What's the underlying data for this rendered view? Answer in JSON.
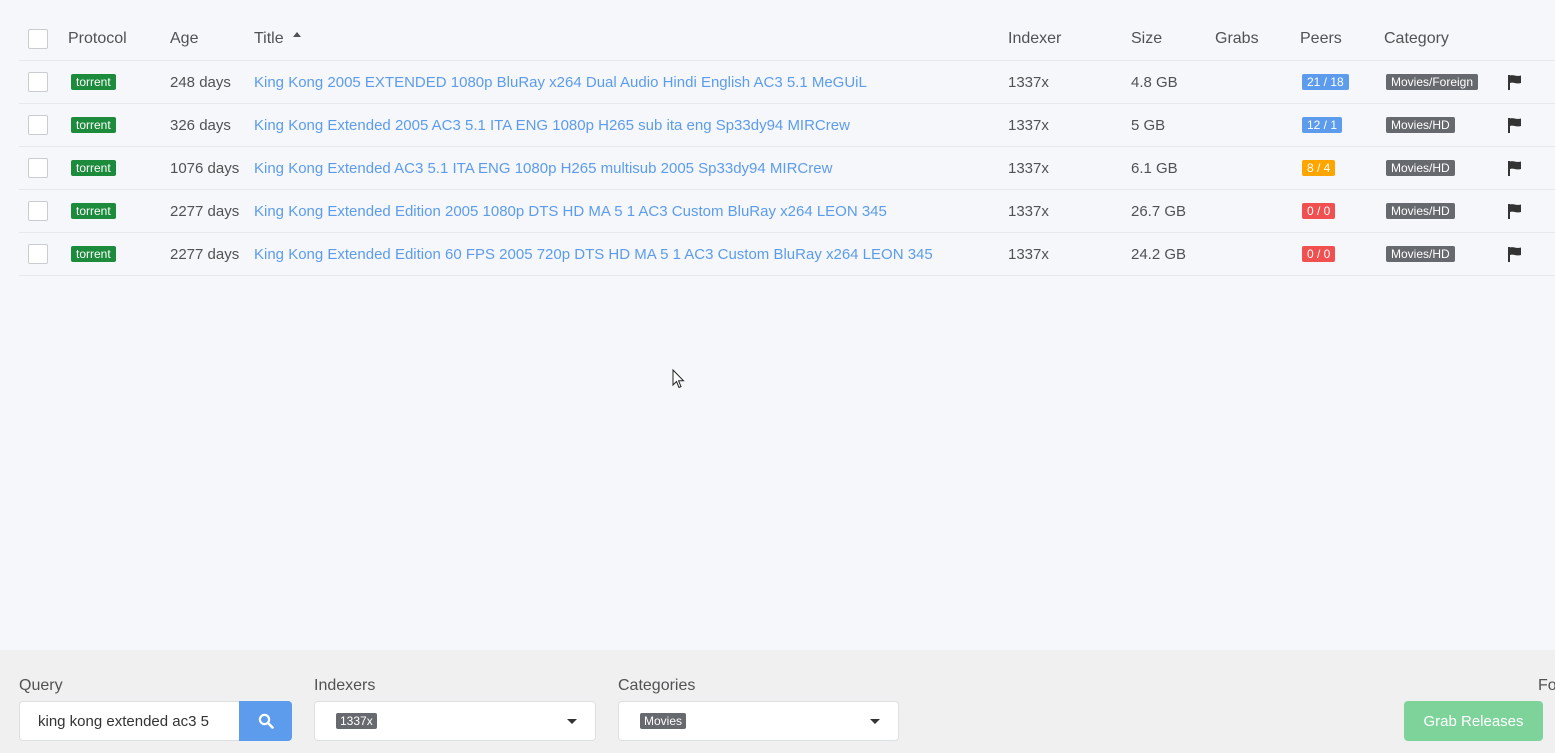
{
  "columns": {
    "protocol": "Protocol",
    "age": "Age",
    "title": "Title",
    "indexer": "Indexer",
    "size": "Size",
    "grabs": "Grabs",
    "peers": "Peers",
    "category": "Category"
  },
  "sort": {
    "column": "Title",
    "direction": "ascending",
    "icon": "sort-up-icon"
  },
  "rows": [
    {
      "protocol": "torrent",
      "age": "248 days",
      "title": "King Kong 2005 EXTENDED 1080p BluRay x264 Dual Audio Hindi English AC3 5.1 MeGUiL",
      "indexer": "1337x",
      "size": "4.8 GB",
      "grabs": "",
      "peers": "21 / 18",
      "peers_color": "#5d9cec",
      "category": "Movies/Foreign"
    },
    {
      "protocol": "torrent",
      "age": "326 days",
      "title": "King Kong Extended 2005 AC3 5.1 ITA ENG 1080p H265 sub ita eng Sp33dy94 MIRCrew",
      "indexer": "1337x",
      "size": "5 GB",
      "grabs": "",
      "peers": "12 / 1",
      "peers_color": "#5d9cec",
      "category": "Movies/HD"
    },
    {
      "protocol": "torrent",
      "age": "1076 days",
      "title": "King Kong Extended AC3 5.1 ITA ENG 1080p H265 multisub 2005 Sp33dy94 MIRCrew",
      "indexer": "1337x",
      "size": "6.1 GB",
      "grabs": "",
      "peers": "8 / 4",
      "peers_color": "#ffa500",
      "category": "Movies/HD"
    },
    {
      "protocol": "torrent",
      "age": "2277 days",
      "title": "King Kong Extended Edition 2005 1080p DTS HD MA 5 1 AC3 Custom BluRay x264 LEON 345",
      "indexer": "1337x",
      "size": "26.7 GB",
      "grabs": "",
      "peers": "0 / 0",
      "peers_color": "#f05050",
      "category": "Movies/HD"
    },
    {
      "protocol": "torrent",
      "age": "2277 days",
      "title": "King Kong Extended Edition 60 FPS 2005 720p DTS HD MA 5 1 AC3 Custom BluRay x264 LEON 345",
      "indexer": "1337x",
      "size": "24.2 GB",
      "grabs": "",
      "peers": "0 / 0",
      "peers_color": "#f05050",
      "category": "Movies/HD"
    }
  ],
  "footer": {
    "query_label": "Query",
    "query_value": "king kong extended ac3 5",
    "indexers_label": "Indexers",
    "indexers_selected": "1337x",
    "categories_label": "Categories",
    "categories_selected": "Movies",
    "cut_label": "Fo",
    "grab_button": "Grab Releases"
  },
  "colors": {
    "link": "#5d9cec",
    "protocol_badge": "#1c8b3c",
    "category_badge": "#666a6e",
    "grab_button": "#7ed39a",
    "search_button": "#5d9cec"
  },
  "icons": {
    "row_action": "flag-icon",
    "search": "search-icon",
    "dropdown": "caret-down-icon"
  }
}
